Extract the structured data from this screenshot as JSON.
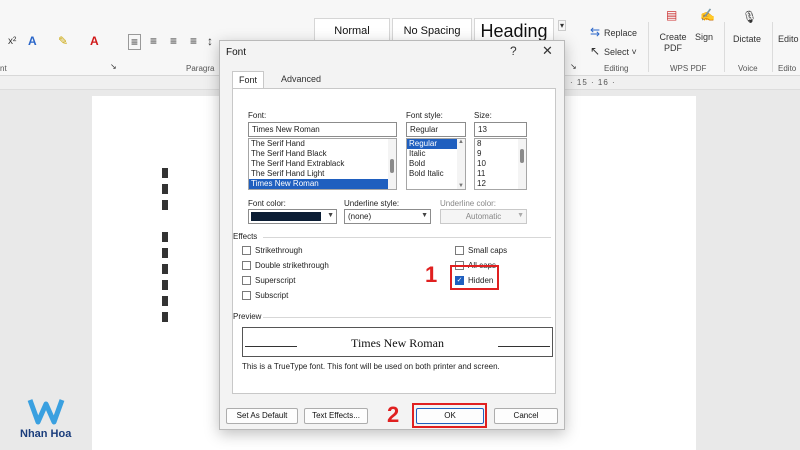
{
  "ribbon": {
    "font_group_label": "nt",
    "paragraph_group_label": "Paragra",
    "styles": [
      "Normal",
      "No Spacing",
      "Heading"
    ],
    "editing": {
      "replace": "Replace",
      "select": "Select ˅",
      "label": "Editing"
    },
    "wps_pdf": {
      "create_pdf": "Create PDF",
      "sign": "Sign",
      "label": "WPS PDF"
    },
    "voice": {
      "dictate": "Dictate",
      "label": "Voice"
    },
    "editor": {
      "label": "Edito",
      "group": "Edito"
    },
    "ruler_text": "· 15 · 16 ·"
  },
  "dialog": {
    "title": "Font",
    "help": "?",
    "close": "✕",
    "tabs": [
      "Font",
      "Advanced"
    ],
    "font_label": "Font:",
    "font_value": "Times New Roman",
    "font_list": [
      "The Serif Hand",
      "The Serif Hand Black",
      "The Serif Hand Extrablack",
      "The Serif Hand Light",
      "Times New Roman"
    ],
    "style_label": "Font style:",
    "style_value": "Regular",
    "style_list": [
      "Regular",
      "Italic",
      "Bold",
      "Bold Italic"
    ],
    "size_label": "Size:",
    "size_value": "13",
    "size_list": [
      "8",
      "9",
      "10",
      "11",
      "12"
    ],
    "font_color_label": "Font color:",
    "underline_style_label": "Underline style:",
    "underline_style_value": "(none)",
    "underline_color_label": "Underline color:",
    "underline_color_value": "Automatic",
    "effects_label": "Effects",
    "effects_left": [
      "Strikethrough",
      "Double strikethrough",
      "Superscript",
      "Subscript"
    ],
    "effects_right": [
      "Small caps",
      "All caps",
      "Hidden"
    ],
    "preview_label": "Preview",
    "preview_text": "Times New Roman",
    "note": "This is a TrueType font. This font will be used on both printer and screen.",
    "buttons": {
      "set_default": "Set As Default",
      "text_effects": "Text Effects...",
      "ok": "OK",
      "cancel": "Cancel"
    }
  },
  "annotations": {
    "step1": "1",
    "step2": "2"
  },
  "logo_text": "Nhan Hoa",
  "colors": {
    "accent": "#1f5fbf",
    "highlight": "#e02020",
    "font_color": "#0b1d34"
  }
}
